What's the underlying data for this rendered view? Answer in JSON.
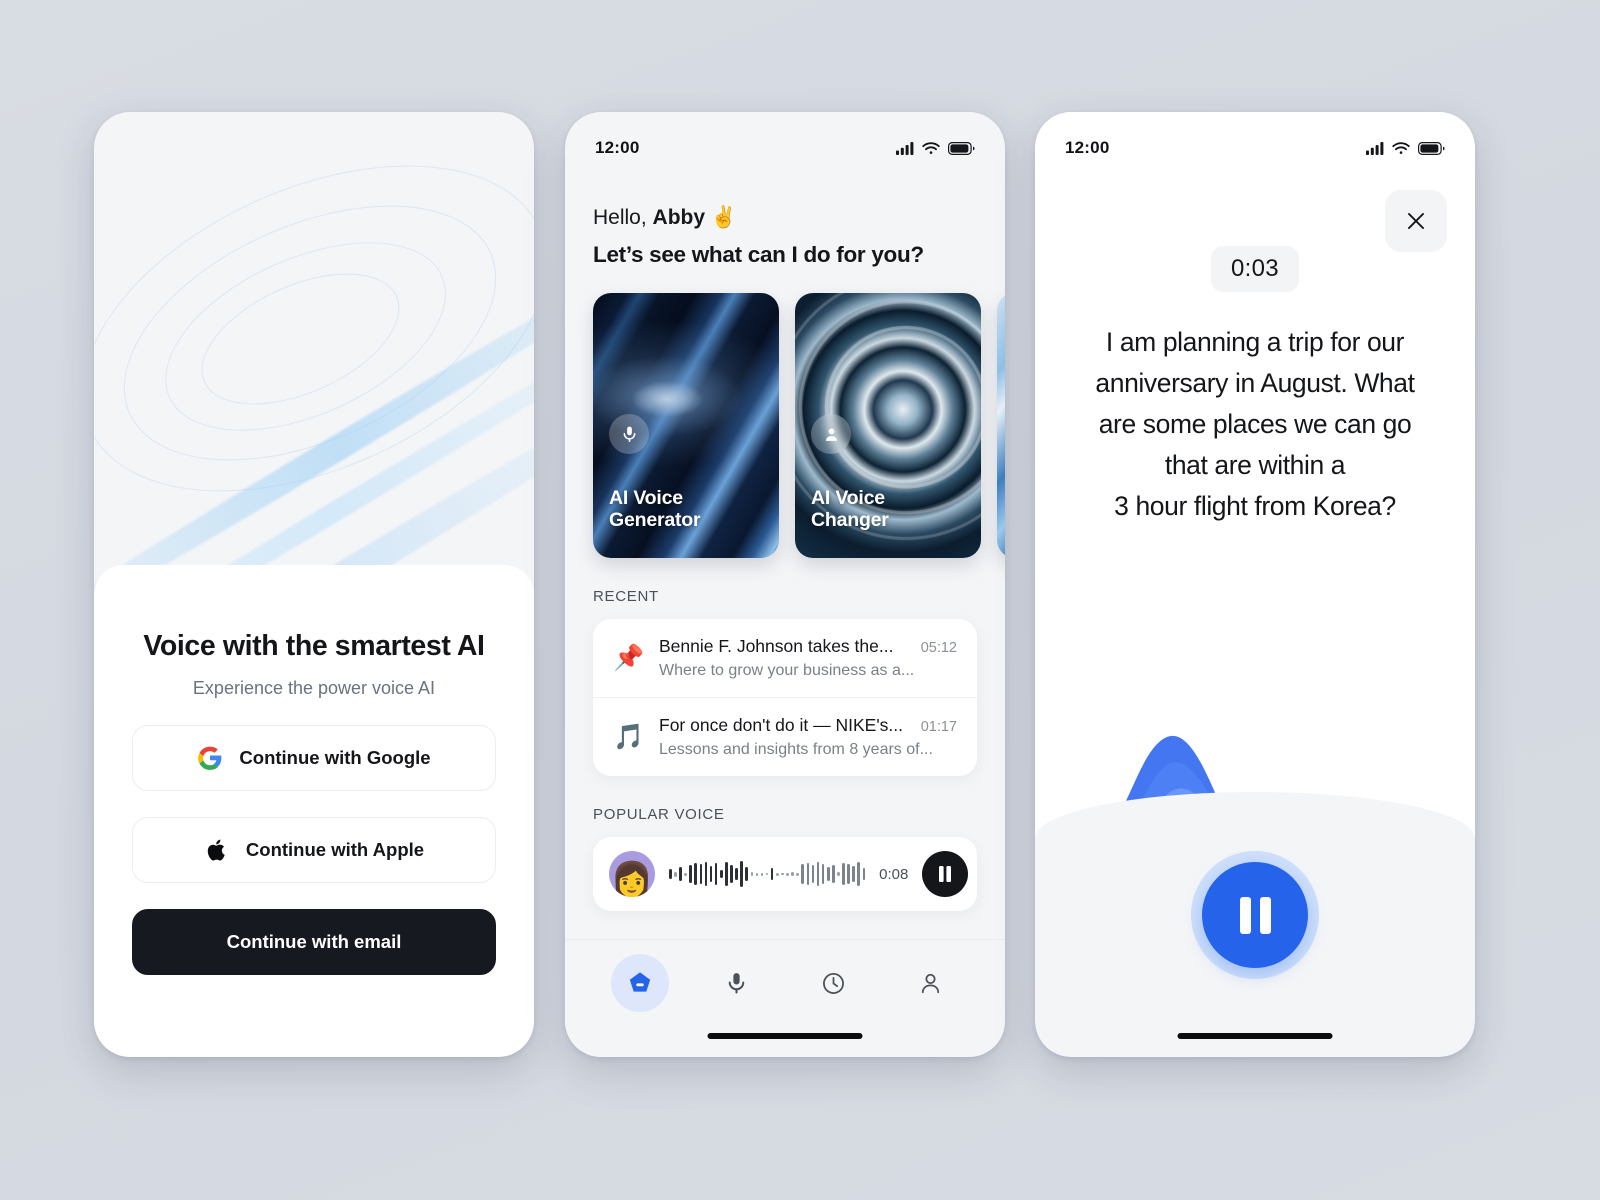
{
  "background_color": "#d6dae1",
  "accent_color": "#2563eb",
  "phone1": {
    "name": "onboarding-signin-screen",
    "hero_image_alt": "abstract-blue-ripple-artwork",
    "title": "Voice with the smartest AI",
    "subtitle": "Experience the power voice AI",
    "buttons": [
      {
        "label": "Continue with Google",
        "icon": "google-icon",
        "style": "outline"
      },
      {
        "label": "Continue with Apple",
        "icon": "apple-icon",
        "style": "outline"
      },
      {
        "label": "Continue with email",
        "icon": "none",
        "style": "primary"
      }
    ]
  },
  "phone2": {
    "name": "home-screen",
    "statusbar": {
      "time": "12:00",
      "icons": [
        "cellular-icon",
        "wifi-icon",
        "battery-icon"
      ]
    },
    "greeting_prefix": "Hello, ",
    "greeting_name": "Abby",
    "greeting_emoji": "✌️",
    "greeting_question": "Let’s see what can I do for you?",
    "cards": [
      {
        "label": "AI Voice\nGenerator",
        "label_line1": "AI Voice",
        "label_line2": "Generator",
        "icon": "microphone-icon"
      },
      {
        "label": "AI Voice\nChanger",
        "label_line1": "AI Voice",
        "label_line2": "Changer",
        "icon": "person-icon"
      },
      {
        "label": "",
        "label_line1": "",
        "label_line2": "",
        "icon": "none"
      }
    ],
    "recent": {
      "section_title": "RECENT",
      "items": [
        {
          "emoji": "📌",
          "icon": "pin-icon",
          "title": "Bennie F. Johnson takes the...",
          "subtitle": "Where to grow your business as a...",
          "duration": "05:12"
        },
        {
          "emoji": "🎵",
          "icon": "music-note-icon",
          "title": "For once don't do it — NIKE's...",
          "subtitle": "Lessons and insights from 8 years of...",
          "duration": "01:17"
        }
      ]
    },
    "popular": {
      "section_title": "POPULAR VOICE",
      "item": {
        "avatar": "👩",
        "duration": "0:08",
        "play_state": "pause",
        "waveform": [
          10,
          5,
          14,
          3,
          18,
          22,
          20,
          24,
          16,
          22,
          8,
          24,
          18,
          12,
          26,
          14,
          4,
          3,
          3,
          2,
          12,
          3,
          2,
          3,
          4,
          3,
          20,
          22,
          18,
          24,
          20,
          14,
          18,
          4,
          22,
          20,
          16,
          24,
          12
        ]
      }
    },
    "tabs": [
      {
        "name": "tab-home",
        "icon": "home-pentagon-icon",
        "active": true
      },
      {
        "name": "tab-record",
        "icon": "microphone-icon",
        "active": false
      },
      {
        "name": "tab-history",
        "icon": "clock-icon",
        "active": false
      },
      {
        "name": "tab-profile",
        "icon": "person-icon",
        "active": false
      }
    ]
  },
  "phone3": {
    "name": "voice-playback-screen",
    "statusbar": {
      "time": "12:00",
      "icons": [
        "cellular-icon",
        "wifi-icon",
        "battery-icon"
      ]
    },
    "close_icon": "close-icon",
    "timer": "0:03",
    "transcript_lines": [
      "I am planning a trip for our",
      "anniversary in August. What",
      "are some places we can go",
      "that are within a",
      "3 hour flight from Korea?"
    ],
    "player": {
      "state": "pause",
      "icon": "pause-icon"
    },
    "waveform_color": "#2f62e8"
  }
}
